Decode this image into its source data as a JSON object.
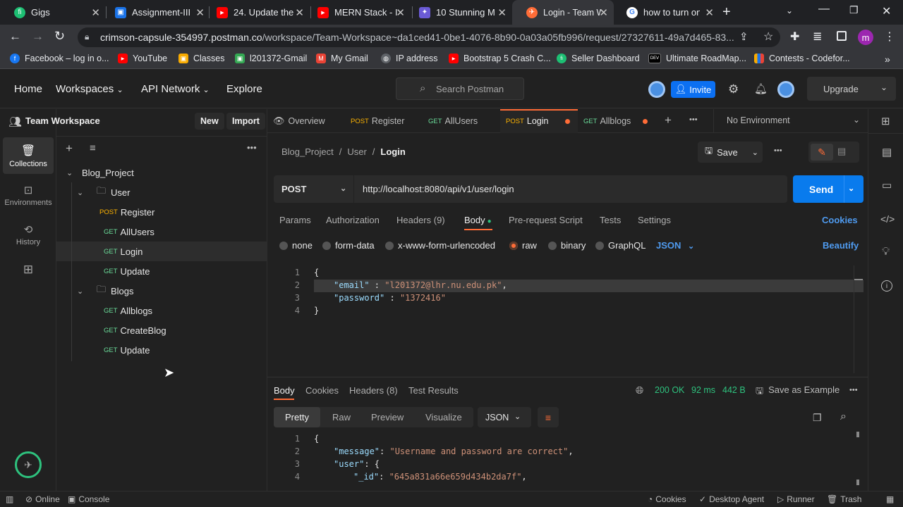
{
  "browser": {
    "tabs": [
      {
        "title": "Gigs",
        "icon": "fiverr-icon",
        "color": "#1dbf73",
        "glyph": "fi"
      },
      {
        "title": "Assignment-III",
        "icon": "classroom-icon",
        "color": "#1a73e8",
        "glyph": "▣"
      },
      {
        "title": "24. Update the",
        "icon": "youtube-icon",
        "color": "#ff0000",
        "glyph": "▶"
      },
      {
        "title": "MERN Stack - I",
        "icon": "youtube-icon",
        "color": "#ff0000",
        "glyph": "▶"
      },
      {
        "title": "10 Stunning M",
        "icon": "site-icon",
        "color": "#6b5bd6",
        "glyph": "✦"
      },
      {
        "title": "Login - Team W",
        "icon": "postman-icon",
        "color": "#ff6c37",
        "glyph": "✈"
      },
      {
        "title": "how to turn on",
        "icon": "google-icon",
        "color": "#4285f4",
        "glyph": "G"
      }
    ],
    "new_tab": "+",
    "url_domain": "crimson-capsule-354997.postman.co",
    "url_path": "/workspace/Team-Workspace~da1ced41-0be1-4076-8b90-0a03a05fb996/request/27327611-49a7d465-83...",
    "profile_initial": "m",
    "bookmarks": [
      {
        "label": "Facebook – log in o...",
        "color": "#1877f2",
        "glyph": "f"
      },
      {
        "label": "YouTube",
        "color": "#ff0000",
        "glyph": "▶"
      },
      {
        "label": "Classes",
        "color": "#f9ab00",
        "glyph": "▣"
      },
      {
        "label": "l201372-Gmail",
        "color": "#34a853",
        "glyph": "▣"
      },
      {
        "label": "My Gmail",
        "color": "#ea4335",
        "glyph": "M"
      },
      {
        "label": "IP address",
        "color": "#5f6368",
        "glyph": "◍"
      },
      {
        "label": "Bootstrap 5 Crash C...",
        "color": "#ff0000",
        "glyph": "▶"
      },
      {
        "label": "Seller Dashboard",
        "color": "#1dbf73",
        "glyph": "fi"
      },
      {
        "label": "Ultimate RoadMap...",
        "color": "#000000",
        "glyph": "DEV"
      },
      {
        "label": "Contests - Codefor...",
        "color": "#f9ab00",
        "glyph": "▮"
      }
    ],
    "bookmarks_more": "»"
  },
  "postman": {
    "nav": [
      "Home",
      "Workspaces",
      "API Network",
      "Explore"
    ],
    "search_placeholder": "Search Postman",
    "invite_label": "Invite",
    "upgrade_label": "Upgrade",
    "workspace_name": "Team Workspace",
    "new_label": "New",
    "import_label": "Import",
    "rail": [
      {
        "label": "Collections",
        "icon": "collections-icon"
      },
      {
        "label": "Environments",
        "icon": "environments-icon"
      },
      {
        "label": "History",
        "icon": "history-icon"
      },
      {
        "label": "",
        "icon": "add-apps-icon"
      }
    ],
    "tree": {
      "collection": "Blog_Project",
      "folders": [
        {
          "name": "User",
          "requests": [
            {
              "method": "POST",
              "name": "Register"
            },
            {
              "method": "GET",
              "name": "AllUsers"
            },
            {
              "method": "GET",
              "name": "Login"
            },
            {
              "method": "GET",
              "name": "Update"
            }
          ]
        },
        {
          "name": "Blogs",
          "requests": [
            {
              "method": "GET",
              "name": "Allblogs"
            },
            {
              "method": "GET",
              "name": "CreateBlog"
            },
            {
              "method": "GET",
              "name": "Update"
            }
          ]
        }
      ]
    },
    "open_tabs": [
      {
        "method": "",
        "name": "Overview"
      },
      {
        "method": "POST",
        "name": "Register"
      },
      {
        "method": "GET",
        "name": "AllUsers"
      },
      {
        "method": "POST",
        "name": "Login"
      },
      {
        "method": "GET",
        "name": "Allblogs"
      }
    ],
    "environment": "No Environment",
    "breadcrumb": [
      "Blog_Project",
      "User",
      "Login"
    ],
    "save_label": "Save",
    "method": "POST",
    "url": "http://localhost:8080/api/v1/user/login",
    "send_label": "Send",
    "request_tabs": [
      "Params",
      "Authorization",
      "Headers (9)",
      "Body",
      "Pre-request Script",
      "Tests",
      "Settings"
    ],
    "cookies_label": "Cookies",
    "body_types": [
      "none",
      "form-data",
      "x-www-form-urlencoded",
      "raw",
      "binary",
      "GraphQL"
    ],
    "body_format": "JSON",
    "beautify_label": "Beautify",
    "request_body": {
      "line_numbers": [
        "1",
        "2",
        "3",
        "4"
      ],
      "open": "{",
      "email_key": "\"email\"",
      "email_value": "\"l201372@lhr.nu.edu.pk\"",
      "password_key": "\"password\"",
      "password_value": "\"1372416\"",
      "close": "}"
    },
    "response": {
      "tabs": [
        "Body",
        "Cookies",
        "Headers (8)",
        "Test Results"
      ],
      "status": "200 OK",
      "time": "92 ms",
      "size": "442 B",
      "save_example": "Save as Example",
      "views": [
        "Pretty",
        "Raw",
        "Preview",
        "Visualize"
      ],
      "format": "JSON",
      "line_numbers": [
        "1",
        "2",
        "3",
        "4"
      ],
      "open": "{",
      "message_key": "\"message\"",
      "message_value": "\"Username and password are correct\"",
      "user_key": "\"user\"",
      "id_key": "\"_id\"",
      "id_value": "\"645a831a66e659d434b2da7f\""
    },
    "statusbar": {
      "online": "Online",
      "console": "Console",
      "cookies": "Cookies",
      "agent": "Desktop Agent",
      "runner": "Runner",
      "trash": "Trash"
    }
  }
}
